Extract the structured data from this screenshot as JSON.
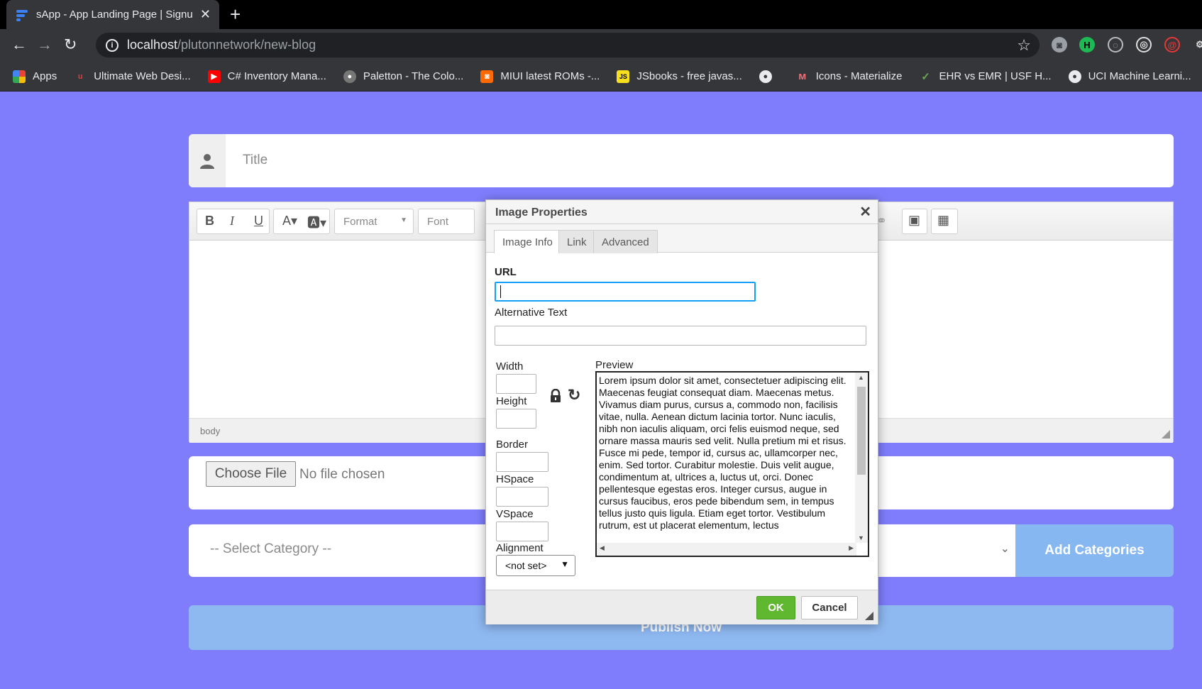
{
  "browser": {
    "tab_title": "sApp - App Landing Page | Signu",
    "url_host": "localhost",
    "url_path": "/plutonnetwork/new-blog",
    "bookmarks": [
      {
        "label": "Apps",
        "icon": "apps-grid-icon",
        "color": "#ea4335"
      },
      {
        "label": "Ultimate Web Desi...",
        "icon": "brand-u-icon",
        "color": "#e53935"
      },
      {
        "label": "C# Inventory Mana...",
        "icon": "youtube-icon",
        "color": "#ff0000"
      },
      {
        "label": "Paletton - The Colo...",
        "icon": "paletton-icon",
        "color": "#777777"
      },
      {
        "label": "MIUI latest ROMs -...",
        "icon": "miui-icon",
        "color": "#ff6a00"
      },
      {
        "label": "JSbooks - free javas...",
        "icon": "js-icon",
        "color": "#f7df1e"
      },
      {
        "label": "",
        "icon": "globe-icon",
        "color": "#e8eaed"
      },
      {
        "label": "Icons - Materialize",
        "icon": "materialize-icon",
        "color": "#ee6e73"
      },
      {
        "label": "EHR vs EMR | USF H...",
        "icon": "usf-icon",
        "color": "#6aa84f"
      },
      {
        "label": "UCI Machine Learni...",
        "icon": "globe-icon",
        "color": "#e8eaed"
      }
    ]
  },
  "page": {
    "title_placeholder": "Title",
    "editor": {
      "format_label": "Format",
      "font_label": "Font",
      "status_path": "body"
    },
    "file": {
      "choose_label": "Choose File",
      "status": "No file chosen"
    },
    "category_placeholder": "-- Select Category --",
    "add_categories_label": "Add Categories",
    "publish_label": "Publish Now"
  },
  "dialog": {
    "title": "Image Properties",
    "tabs": [
      "Image Info",
      "Link",
      "Advanced"
    ],
    "active_tab": "Image Info",
    "url_label": "URL",
    "url_value": "",
    "alt_label": "Alternative Text",
    "alt_value": "",
    "width_label": "Width",
    "height_label": "Height",
    "border_label": "Border",
    "hspace_label": "HSpace",
    "vspace_label": "VSpace",
    "alignment_label": "Alignment",
    "alignment_value": "<not set>",
    "preview_label": "Preview",
    "preview_text": "Lorem ipsum dolor sit amet, consectetuer adipiscing elit. Maecenas feugiat consequat diam. Maecenas metus. Vivamus diam purus, cursus a, commodo non, facilisis vitae, nulla. Aenean dictum lacinia tortor. Nunc iaculis, nibh non iaculis aliquam, orci felis euismod neque, sed ornare massa mauris sed velit. Nulla pretium mi et risus. Fusce mi pede, tempor id, cursus ac, ullamcorper nec, enim. Sed tortor. Curabitur molestie. Duis velit augue, condimentum at, ultrices a, luctus ut, orci. Donec pellentesque egestas eros. Integer cursus, augue in cursus faucibus, eros pede bibendum sem, in tempus tellus justo quis ligula. Etiam eget tortor. Vestibulum rutrum, est ut placerat elementum, lectus",
    "ok_label": "OK",
    "cancel_label": "Cancel"
  },
  "colors": {
    "page_background": "#7f7dfb",
    "add_button": "#86b7f1",
    "publish_button": "#8eb8f0",
    "ok_button": "#5fb82f",
    "focus_border": "#139ff7"
  }
}
